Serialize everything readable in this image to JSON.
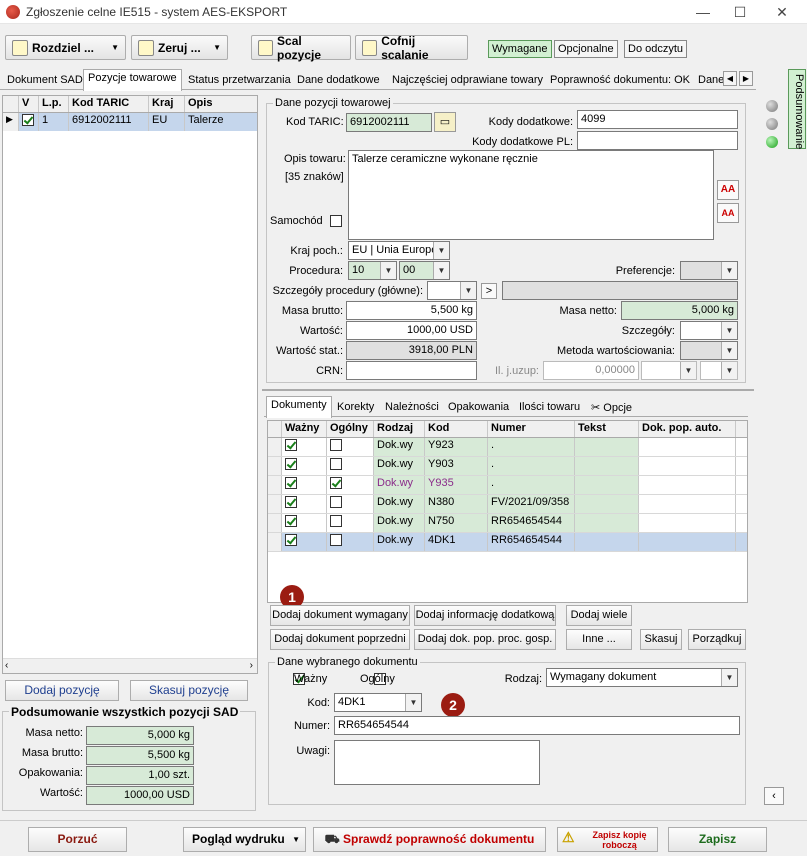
{
  "window": {
    "title": "Zgłoszenie celne IE515 - system AES-EKSPORT",
    "min": "—",
    "max": "☐",
    "close": "✕"
  },
  "toolbar": {
    "split": "Rozdziel ...",
    "reset": "Zeruj ...",
    "merge": "Scal pozycje",
    "unmerge": "Cofnij scalanie",
    "filters": [
      "Wymagane",
      "Opcjonalne",
      "Do odczytu"
    ],
    "active_filter": "Wymagane"
  },
  "tabs": [
    "Dokument SAD",
    "Pozycje towarowe",
    "Status przetwarzania",
    "Dane dodatkowe",
    "Najczęściej odprawiane towary",
    "Poprawność dokumentu: OK",
    "Dane"
  ],
  "active_tab": "Pozycje towarowe",
  "side_tab": "Podsumowanie",
  "item_grid": {
    "headers": [
      "V",
      "L.p.",
      "Kod TARIC",
      "Kraj",
      "Opis"
    ],
    "rows": [
      {
        "lp": "1",
        "taric": "6912002111",
        "kraj": "EU",
        "opis": "Talerze"
      }
    ]
  },
  "left_buttons": {
    "add": "Dodaj pozycję",
    "delete": "Skasuj pozycję"
  },
  "summary": {
    "title": "Podsumowanie wszystkich pozycji SAD",
    "rows": [
      {
        "label": "Masa netto:",
        "value": "5,000 kg"
      },
      {
        "label": "Masa brutto:",
        "value": "5,500 kg"
      },
      {
        "label": "Opakowania:",
        "value": "1,00 szt."
      },
      {
        "label": "Wartość:",
        "value": "1000,00 USD"
      }
    ]
  },
  "item_data": {
    "caption": "Dane pozycji towarowej",
    "taric_label": "Kod TARIC:",
    "taric": "6912002111",
    "extra_codes_label": "Kody dodatkowe:",
    "extra_codes": "4099",
    "extra_codes_pl_label": "Kody dodatkowe PL:",
    "extra_codes_pl": "",
    "desc_label": "Opis towaru:",
    "desc_count": "[35 znaków]",
    "desc": "Talerze ceramiczne wykonane ręcznie",
    "vehicle_label": "Samochód",
    "origin_label": "Kraj poch.:",
    "origin": "EU | Unia Europe",
    "procedure_label": "Procedura:",
    "proc1": "10",
    "proc2": "00",
    "preferences_label": "Preferencje:",
    "proc_details_label": "Szczegóły procedury (główne):",
    "gross_label": "Masa brutto:",
    "gross": "5,500 kg",
    "net_label": "Masa netto:",
    "net": "5,000 kg",
    "value_label": "Wartość:",
    "value": "1000,00 USD",
    "details_label": "Szczegóły:",
    "stat_value_label": "Wartość stat.:",
    "stat_value": "3918,00 PLN",
    "valuation_label": "Metoda wartościowania:",
    "crn_label": "CRN:",
    "qty_label": "Il. j.uzup:",
    "qty": "0,00000",
    "font_up": "AA",
    "font_down": "AA",
    "expand": ">"
  },
  "subtabs": [
    "Dokumenty",
    "Korekty",
    "Należności",
    "Opakowania",
    "Ilości towaru",
    "Opcje"
  ],
  "active_subtab": "Dokumenty",
  "doc_grid": {
    "headers": [
      "Ważny",
      "Ogólny",
      "Rodzaj",
      "Kod",
      "Numer",
      "Tekst",
      "Dok. pop. auto."
    ],
    "rows": [
      {
        "wazny": true,
        "ogolny": false,
        "rodzaj": "Dok.wy",
        "kod": "Y923",
        "numer": ".",
        "purple": false
      },
      {
        "wazny": true,
        "ogolny": false,
        "rodzaj": "Dok.wy",
        "kod": "Y903",
        "numer": ".",
        "purple": false
      },
      {
        "wazny": true,
        "ogolny": true,
        "rodzaj": "Dok.wy",
        "kod": "Y935",
        "numer": ".",
        "purple": true
      },
      {
        "wazny": true,
        "ogolny": false,
        "rodzaj": "Dok.wy",
        "kod": "N380",
        "numer": "FV/2021/09/358",
        "purple": false
      },
      {
        "wazny": true,
        "ogolny": false,
        "rodzaj": "Dok.wy",
        "kod": "N750",
        "numer": "RR654654544",
        "purple": false
      },
      {
        "wazny": true,
        "ogolny": false,
        "rodzaj": "Dok.wy",
        "kod": "4DK1",
        "numer": "RR654654544",
        "purple": false
      }
    ]
  },
  "doc_buttons": {
    "add_required": "Dodaj dokument wymagany",
    "add_info": "Dodaj informację dodatkową",
    "add_many": "Dodaj wiele",
    "add_prev": "Dodaj dokument poprzedni",
    "add_prev_proc": "Dodaj dok. pop. proc. gosp.",
    "other": "Inne ...",
    "delete": "Skasuj",
    "sort": "Porządkuj"
  },
  "selected_doc": {
    "caption": "Dane wybranego dokumentu",
    "valid_label": "Ważny",
    "general_label": "Ogólny",
    "type_label": "Rodzaj:",
    "type": "Wymagany dokument",
    "code_label": "Kod:",
    "code": "4DK1",
    "number_label": "Numer:",
    "number": "RR654654544",
    "notes_label": "Uwagi:",
    "notes": ""
  },
  "badges": [
    "1",
    "2"
  ],
  "bottom": {
    "discard": "Porzuć",
    "preview": "Pogląd wydruku",
    "check": "Sprawdź poprawność dokumentu",
    "draft": "Zapisz kopię roboczą",
    "save": "Zapisz"
  },
  "colors": {
    "green_field": "#d7ead7",
    "selected_row": "#c5d6ec",
    "badge": "#9b1c12",
    "check_red": "#c00000"
  }
}
